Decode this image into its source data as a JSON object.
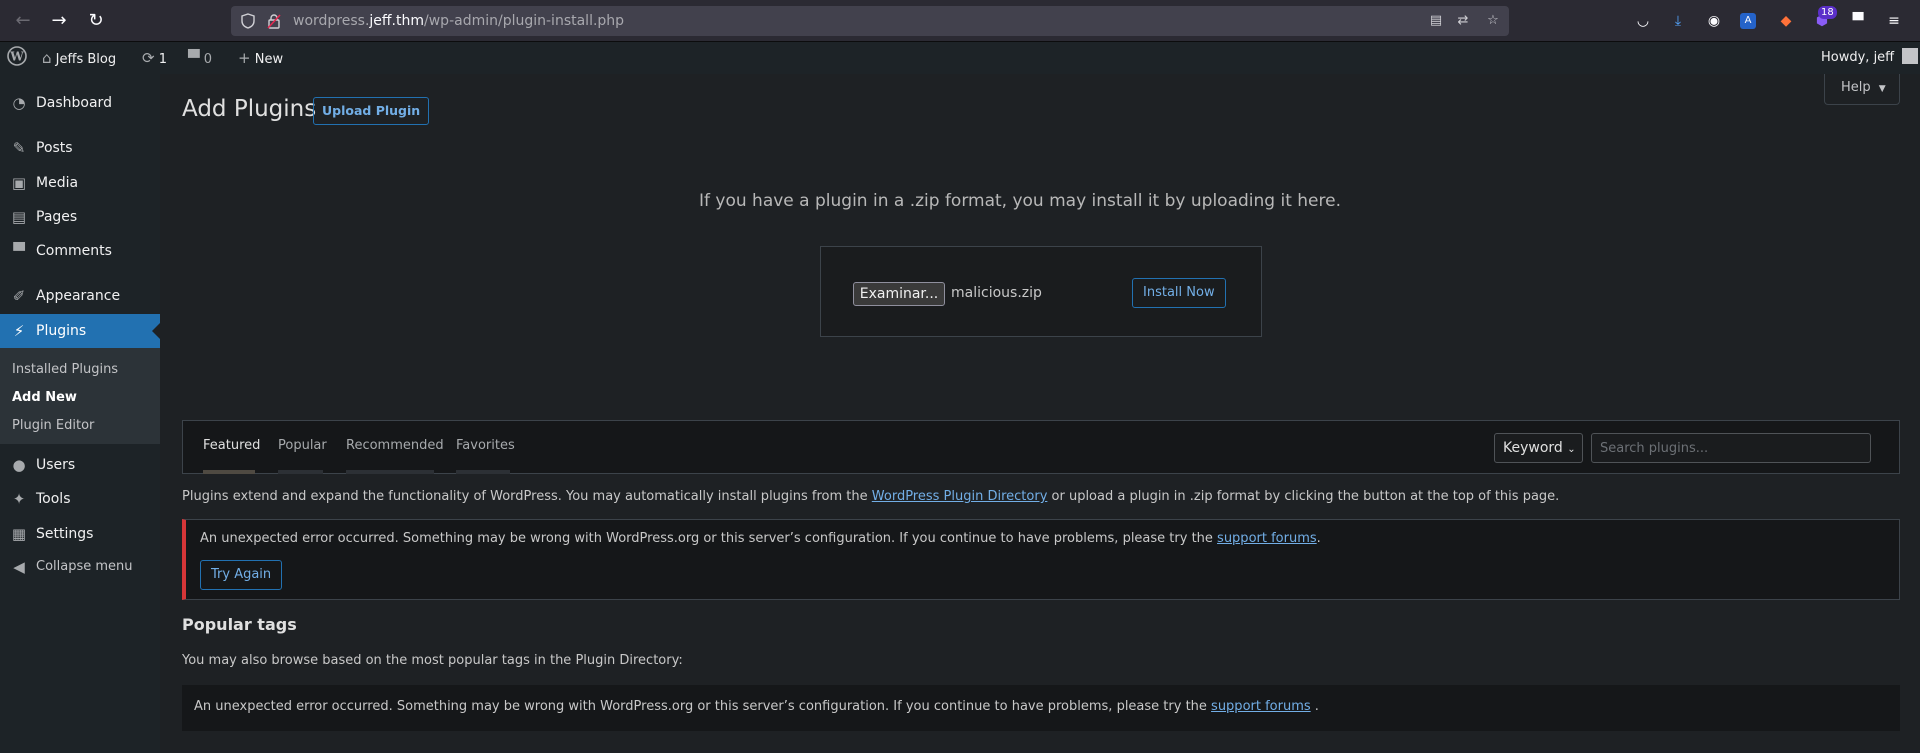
{
  "browser": {
    "url_prefix": "wordpress.",
    "url_host": "jeff.thm",
    "url_path": "/wp-admin/plugin-install.php",
    "badge_count": "18"
  },
  "admin_bar": {
    "site_name": "Jeffs Blog",
    "updates_count": "1",
    "comments_count": "0",
    "new_label": "New",
    "howdy": "Howdy, jeff"
  },
  "sidebar": {
    "items": [
      {
        "label": "Dashboard"
      },
      {
        "label": "Posts"
      },
      {
        "label": "Media"
      },
      {
        "label": "Pages"
      },
      {
        "label": "Comments"
      },
      {
        "label": "Appearance"
      },
      {
        "label": "Plugins"
      },
      {
        "label": "Users"
      },
      {
        "label": "Tools"
      },
      {
        "label": "Settings"
      },
      {
        "label": "Collapse menu"
      }
    ],
    "submenu": [
      "Installed Plugins",
      "Add New",
      "Plugin Editor"
    ]
  },
  "main": {
    "help_label": "Help",
    "title": "Add Plugins",
    "upload_plugin_label": "Upload Plugin",
    "upload_hint": "If you have a plugin in a .zip format, you may install it by uploading it here.",
    "browse_label": "Examinar...",
    "file_name": "malicious.zip",
    "install_now_label": "Install Now",
    "tabs": [
      "Featured",
      "Popular",
      "Recommended",
      "Favorites"
    ],
    "keyword_label": "Keyword",
    "search_placeholder": "Search plugins...",
    "intro_before": "Plugins extend and expand the functionality of WordPress. You may automatically install plugins from the ",
    "intro_link": "WordPress Plugin Directory",
    "intro_after": " or upload a plugin in .zip format by clicking the button at the top of this page.",
    "error_text": "An unexpected error occurred. Something may be wrong with WordPress.org or this server’s configuration. If you continue to have problems, please try the ",
    "error_link": "support forums",
    "error_end": ".",
    "try_again_label": "Try Again",
    "popular_title": "Popular tags",
    "popular_desc": "You may also browse based on the most popular tags in the Plugin Directory:",
    "error2_text": "An unexpected error occurred. Something may be wrong with WordPress.org or this server’s configuration. If you continue to have problems, please try the ",
    "error2_link": "support forums",
    "error2_end": " ."
  }
}
